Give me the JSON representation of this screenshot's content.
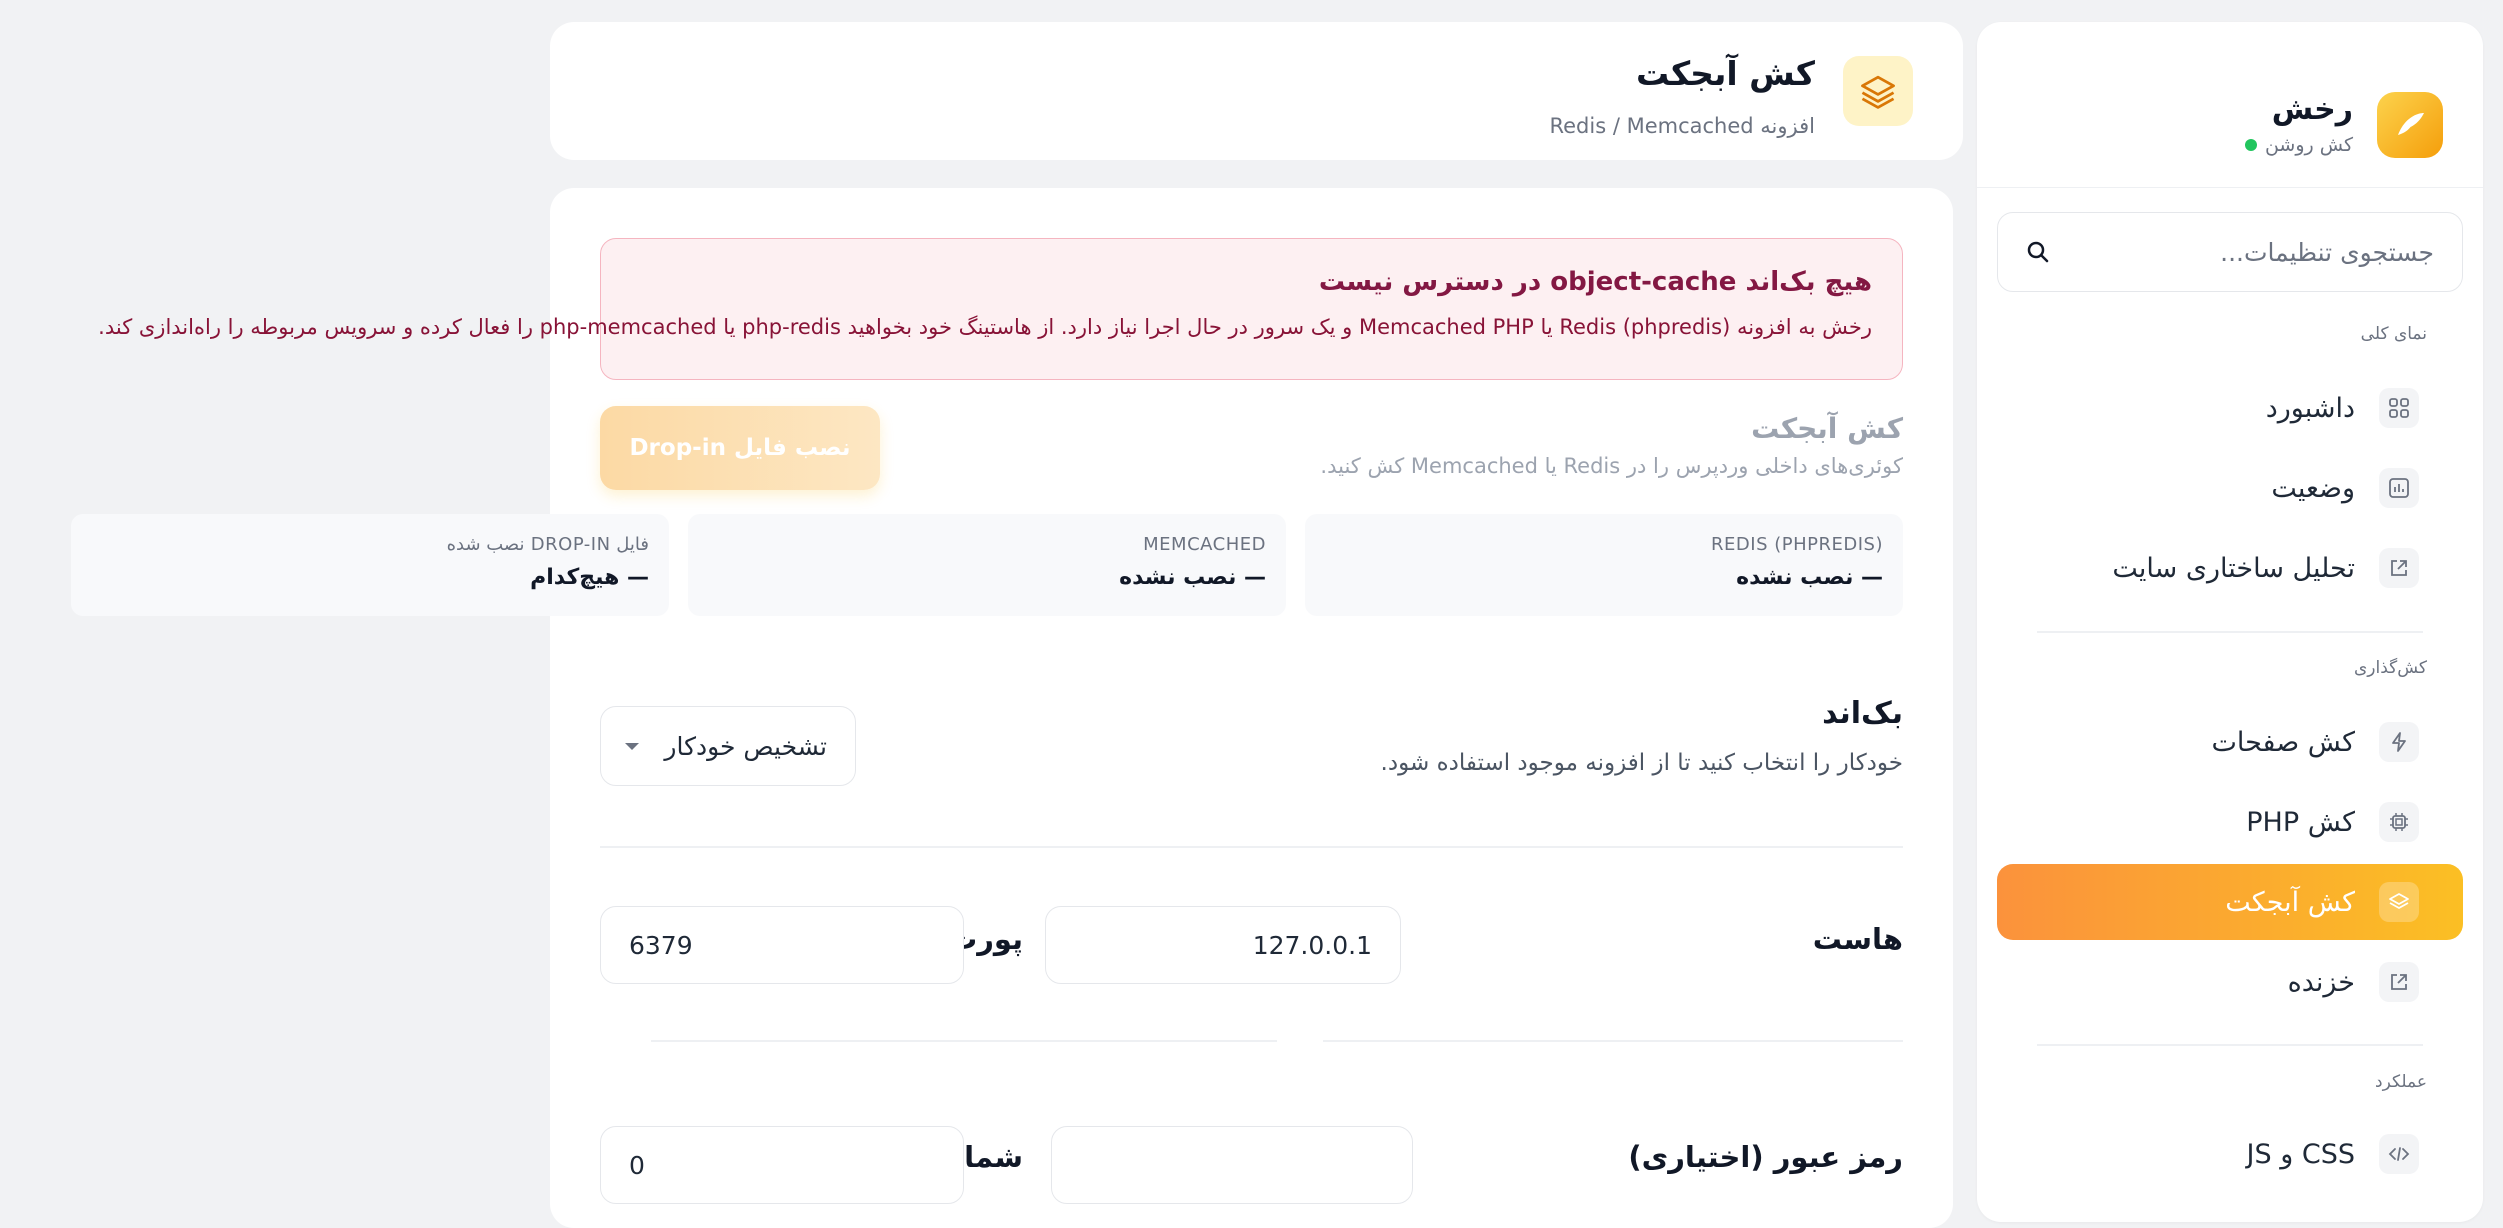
{
  "sidebar": {
    "brand_title": "رخش",
    "brand_status": "کش روشن",
    "search_placeholder": "جستجوی تنظیمات...",
    "sections": [
      {
        "label": "نمای کلی"
      },
      {
        "label": "کش‌گذاری"
      },
      {
        "label": "عملکرد"
      }
    ],
    "items": [
      {
        "label": "داشبورد",
        "icon": "grid-icon"
      },
      {
        "label": "وضعیت",
        "icon": "chart-icon"
      },
      {
        "label": "تحلیل ساختاری سایت",
        "icon": "external-link-icon"
      },
      {
        "label": "کش صفحات",
        "icon": "bolt-icon"
      },
      {
        "label": "کش PHP",
        "icon": "cpu-icon"
      },
      {
        "label": "کش آبجکت",
        "icon": "layers-icon",
        "active": true
      },
      {
        "label": "خزنده",
        "icon": "external-link-icon"
      },
      {
        "label": "CSS و JS",
        "icon": "code-icon"
      }
    ],
    "accent": "#fbbf24"
  },
  "header": {
    "title": "کش آبجکت",
    "subtitle": "افزونه Redis / Memcached"
  },
  "alert": {
    "title": "هیچ بک‌اند object-cache در دسترس نیست",
    "body": "رخش به افزونه Redis (phpredis) یا Memcached PHP و یک سرور در حال اجرا نیاز دارد. از هاستینگ خود بخواهید php-redis یا php-memcached را فعال کرده و سرویس مربوطه را راه‌اندازی کند."
  },
  "section": {
    "title": "کش آبجکت",
    "description": "کوئری‌های داخلی وردپرس را در Redis یا Memcached کش کنید.",
    "install_button": "نصب فایل Drop-in"
  },
  "stats": [
    {
      "label": "REDIS (PHPREDIS)",
      "value": "— نصب نشده"
    },
    {
      "label": "MEMCACHED",
      "value": "— نصب نشده"
    },
    {
      "label": "فایل DROP-IN نصب شده",
      "value": "— هیچ‌کدام"
    }
  ],
  "backend": {
    "title": "بک‌اند",
    "description": "خودکار را انتخاب کنید تا از افزونه موجود استفاده شود.",
    "selected": "تشخیص خودکار"
  },
  "fields": {
    "host_label": "هاست",
    "host_value": "127.0.0.1",
    "port_label": "پورت",
    "port_value": "6379",
    "password_label": "رمز عبور (اختیاری)",
    "password_value": "",
    "db_label": "شماره پایگاه داده Redis",
    "db_value": "0"
  }
}
